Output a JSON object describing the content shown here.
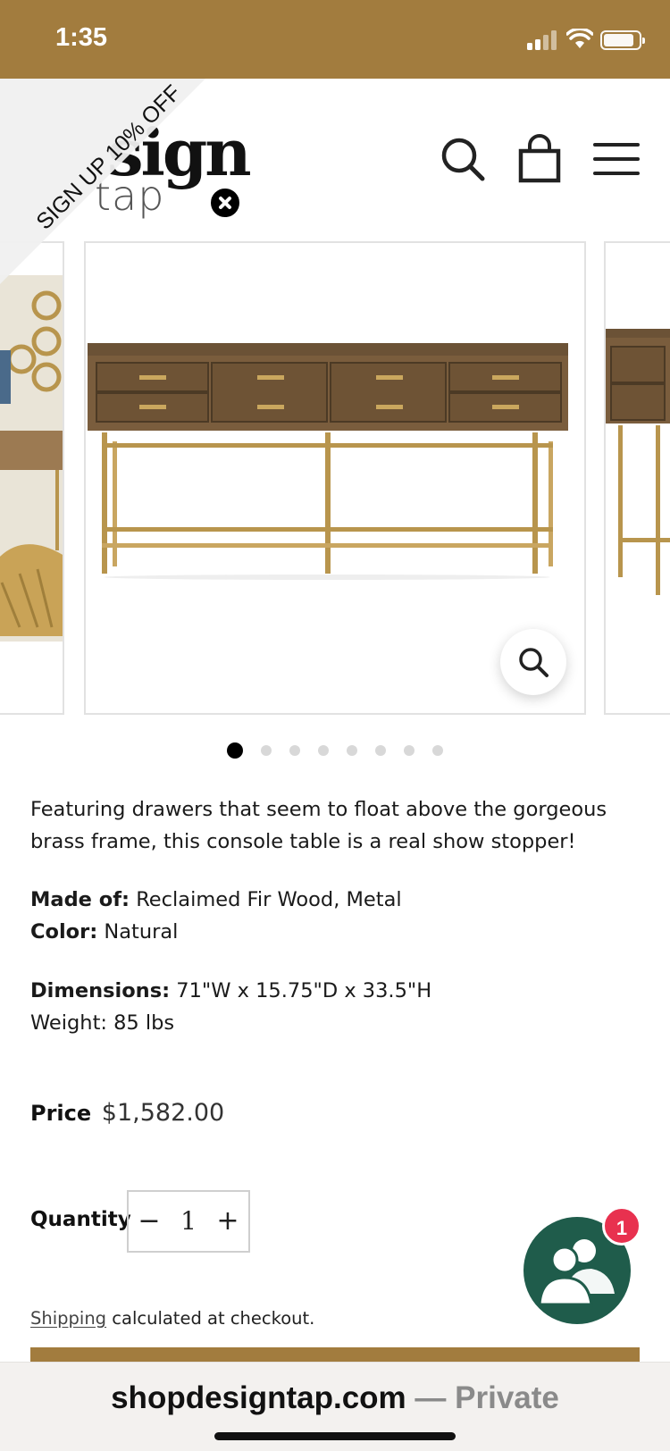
{
  "status_bar": {
    "time": "1:35",
    "background": "#a27c3e"
  },
  "header": {
    "logo_line1": "sign",
    "logo_line2": "tap",
    "icons": [
      "search-icon",
      "shopping-bag-icon",
      "menu-icon"
    ]
  },
  "promo": {
    "text": "SIGN UP 10% OFF",
    "close_icon": "close-icon"
  },
  "gallery": {
    "slides": [
      "console-table-lifestyle",
      "console-table-front",
      "console-table-angle"
    ],
    "active_index": 0,
    "total": 8,
    "zoom_icon": "zoom-icon"
  },
  "product": {
    "description": "Featuring drawers that seem to float above the gorgeous brass frame, this console table is a real show stopper!",
    "made_of_label": "Made of:",
    "made_of_value": "Reclaimed Fir Wood, Metal",
    "color_label": "Color:",
    "color_value": "Natural",
    "dimensions_label": "Dimensions:",
    "dimensions_value": "71\"W x 15.75\"D x 33.5\"H",
    "weight": "Weight: 85 lbs",
    "price_label": "Price",
    "price_value": "$1,582.00",
    "quantity_label": "Quantity",
    "quantity_minus": "−",
    "quantity_value": "1",
    "quantity_plus": "+",
    "shipping_link": "Shipping",
    "shipping_text": " calculated at checkout."
  },
  "chat": {
    "badge_count": "1",
    "icon": "chat-people-icon",
    "color": "#1f5c4b",
    "badge_color": "#e8314f"
  },
  "browser": {
    "domain": "shopdesigntap.com",
    "mode": " — Private"
  }
}
